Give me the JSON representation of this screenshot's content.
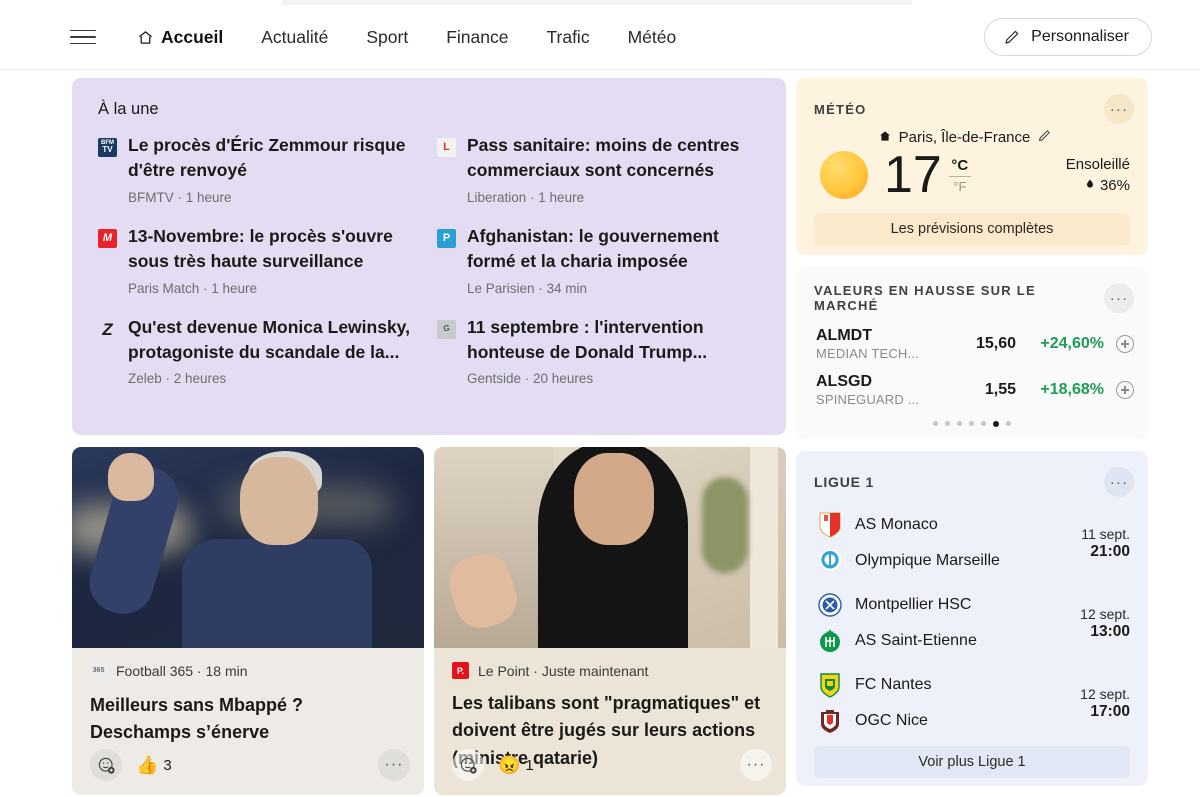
{
  "header": {
    "menu_icon": "hamburger-icon",
    "nav": [
      {
        "label": "Accueil",
        "icon": "home-icon",
        "active": true
      },
      {
        "label": "Actualité",
        "active": false
      },
      {
        "label": "Sport",
        "active": false
      },
      {
        "label": "Finance",
        "active": false
      },
      {
        "label": "Trafic",
        "active": false
      },
      {
        "label": "Météo",
        "active": false
      }
    ],
    "personalize_label": "Personnaliser",
    "personalize_icon": "pencil-icon"
  },
  "headlines": {
    "title": "À la une",
    "left": [
      {
        "title": "Le procès d'Éric Zemmour risque d'être renvoyé",
        "source": "BFMTV",
        "time": "1 heure",
        "meta": "BFMTV · 1 heure",
        "logo_text": "BFM\nTV",
        "logo_bg": "#1b3a63"
      },
      {
        "title": "13-Novembre: le procès s'ouvre sous très haute surveillance",
        "source": "Paris Match",
        "time": "1 heure",
        "meta": "Paris Match · 1 heure",
        "logo_text": "M",
        "logo_bg": "#e8232c"
      },
      {
        "title": "Qu'est devenue Monica Lewinsky, protagoniste du scandale de la...",
        "source": "Zeleb",
        "time": "2 heures",
        "meta": "Zeleb · 2 heures",
        "logo_text": "Z",
        "logo_bg": "#e3dcf2"
      }
    ],
    "right": [
      {
        "title": "Pass sanitaire: moins de centres commerciaux sont concernés",
        "source": "Liberation",
        "time": "1 heure",
        "meta": "Liberation · 1 heure",
        "logo_text": "L",
        "logo_bg": "#d93025"
      },
      {
        "title": "Afghanistan: le gouvernement formé et la charia imposée",
        "source": "Le Parisien",
        "time": "34 min",
        "meta": "Le Parisien · 34 min",
        "logo_text": "P",
        "logo_bg": "#1a7fc1"
      },
      {
        "title": "11 septembre : l'intervention honteuse de Donald Trump...",
        "source": "Gentside",
        "time": "20 heures",
        "meta": "Gentside · 20 heures",
        "logo_text": "G",
        "logo_bg": "#c8c8c8"
      }
    ]
  },
  "articles": [
    {
      "source": "Football 365",
      "time": "18 min",
      "meta": "Football 365 · 18 min",
      "logo_text": "365",
      "logo_bg": "#e9e9e9",
      "title": "Meilleurs sans Mbappé ? Deschamps s’énerve",
      "react_add_icon": "add-reaction-icon",
      "reaction_emoji": "👍",
      "reaction_count": "3",
      "more_icon": "more-options-icon",
      "bg": "#eeebe6",
      "image_alt": "photo-deschamps"
    },
    {
      "source": "Le Point",
      "time": "Juste maintenant",
      "meta": "Le Point · Juste maintenant",
      "logo_text": "P.",
      "logo_bg": "#e1131d",
      "title": "Les talibans sont \"pragmatiques\" et doivent être jugés sur leurs actions (ministre qatarie)",
      "react_add_icon": "add-reaction-icon",
      "reaction_emoji": "😠",
      "reaction_count": "1",
      "more_icon": "more-options-icon",
      "bg": "#ece4d6",
      "image_alt": "photo-qatari-minister"
    }
  ],
  "weather": {
    "card_title": "MÉTÉO",
    "more_icon": "more-options-icon",
    "location": "Paris, Île-de-France",
    "location_icon": "home-icon",
    "edit_icon": "pencil-icon",
    "condition_icon": "sun-icon",
    "temperature": "17",
    "unit_active": "°C",
    "unit_inactive": "°F",
    "condition": "Ensoleillé",
    "humidity": "36%",
    "humidity_icon": "droplet-icon",
    "cta_label": "Les prévisions complètes",
    "accent": "#fdf3de"
  },
  "market": {
    "card_title": "VALEURS EN HAUSSE SUR LE MARCHÉ",
    "more_icon": "more-options-icon",
    "positive_color": "#1f9d55",
    "rows": [
      {
        "symbol": "ALMDT",
        "name": "MEDIAN TECH...",
        "price": "15,60",
        "change": "+24,60%",
        "add_icon": "add-to-watchlist-icon"
      },
      {
        "symbol": "ALSGD",
        "name": "SPINEGUARD ...",
        "price": "1,55",
        "change": "+18,68%",
        "add_icon": "add-to-watchlist-icon"
      }
    ],
    "pager_total": 7,
    "pager_active": 6
  },
  "ligue1": {
    "card_title": "LIGUE 1",
    "more_icon": "more-options-icon",
    "matches": [
      {
        "home": {
          "name": "AS Monaco",
          "crest": "as-monaco-crest",
          "c1": "#e2322b",
          "c2": "#ffffff"
        },
        "away": {
          "name": "Olympique Marseille",
          "crest": "olympique-marseille-crest",
          "c1": "#2fa3dd",
          "c2": "#ffffff"
        },
        "date": "11 sept.",
        "hour": "21:00"
      },
      {
        "home": {
          "name": "Montpellier HSC",
          "crest": "montpellier-hsc-crest",
          "c1": "#2a5caa",
          "c2": "#ffffff"
        },
        "away": {
          "name": "AS Saint-Etienne",
          "crest": "as-saint-etienne-crest",
          "c1": "#10964a",
          "c2": "#ffffff"
        },
        "date": "12 sept.",
        "hour": "13:00"
      },
      {
        "home": {
          "name": "FC Nantes",
          "crest": "fc-nantes-crest",
          "c1": "#f5d417",
          "c2": "#0a8a3c"
        },
        "away": {
          "name": "OGC Nice",
          "crest": "ogc-nice-crest",
          "c1": "#6b2b23",
          "c2": "#e2322b"
        },
        "date": "12 sept.",
        "hour": "17:00"
      }
    ],
    "cta_label": "Voir plus Ligue 1"
  }
}
